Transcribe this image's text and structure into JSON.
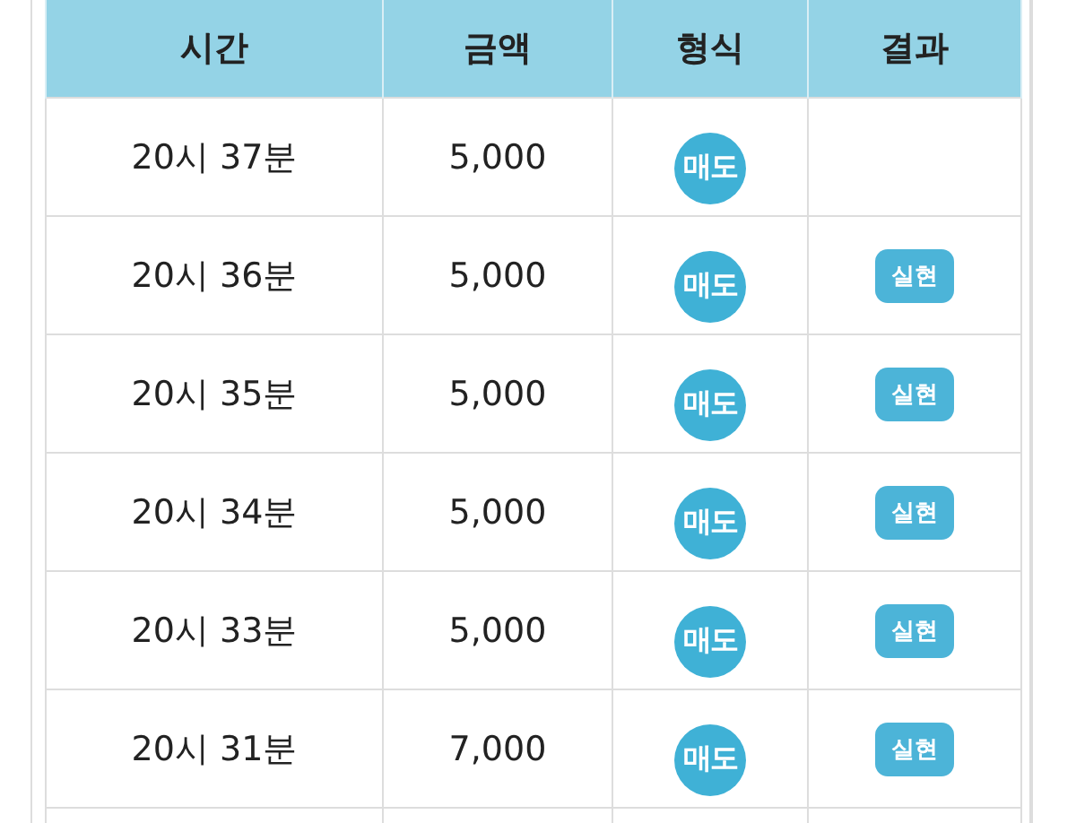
{
  "table": {
    "columns": [
      "시간",
      "금액",
      "형식",
      "결과"
    ],
    "rows": [
      {
        "time": "20시 37분",
        "amount": "5,000",
        "type": "매도"
      },
      {
        "time": "20시 36분",
        "amount": "5,000",
        "type": "매도",
        "result": "실현"
      },
      {
        "time": "20시 35분",
        "amount": "5,000",
        "type": "매도",
        "result": "실현"
      },
      {
        "time": "20시 34분",
        "amount": "5,000",
        "type": "매도",
        "result": "실현"
      },
      {
        "time": "20시 33분",
        "amount": "5,000",
        "type": "매도",
        "result": "실현"
      },
      {
        "time": "20시 31분",
        "amount": "7,000",
        "type": "매도",
        "result": "실현"
      }
    ]
  }
}
